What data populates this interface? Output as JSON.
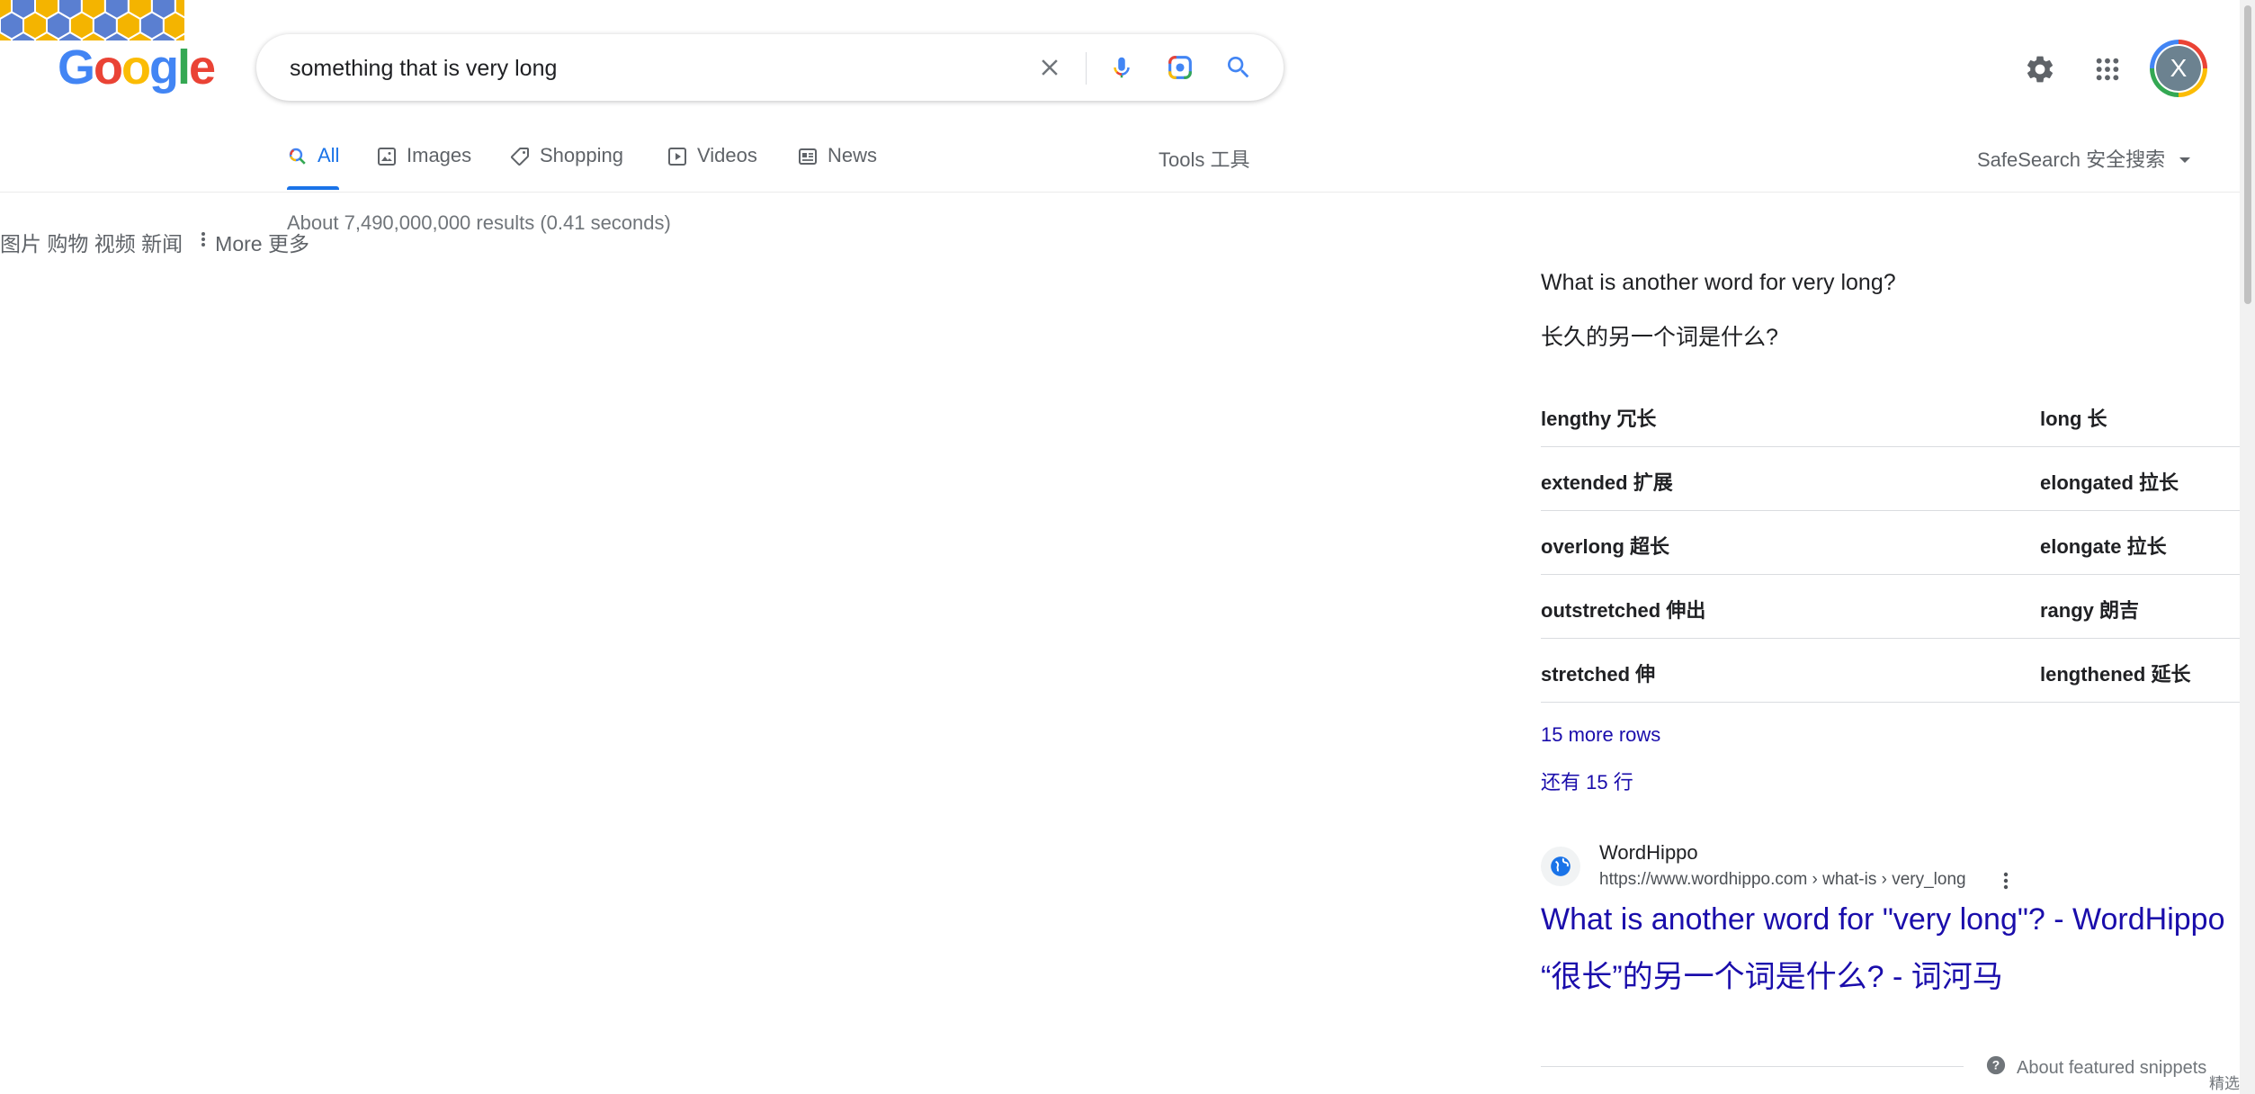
{
  "search": {
    "query": "something that is very long",
    "clear_icon": "close-icon",
    "voice_icon": "mic-icon",
    "lens_icon": "camera-lens-icon",
    "search_icon": "search-icon"
  },
  "logo": {
    "letters": [
      "G",
      "o",
      "o",
      "g",
      "l",
      "e"
    ]
  },
  "header": {
    "settings_icon": "gear-icon",
    "apps_icon": "apps-grid-icon",
    "avatar_initial": "X"
  },
  "tabs": [
    {
      "label": "All",
      "icon": "search-icon",
      "active": true
    },
    {
      "label": "Images",
      "icon": "image-icon"
    },
    {
      "label": "Shopping",
      "icon": "tag-icon"
    },
    {
      "label": "Videos",
      "icon": "play-icon"
    },
    {
      "label": "News",
      "icon": "newspaper-icon"
    }
  ],
  "tools_label": "Tools 工具",
  "safesearch_label": "SafeSearch 安全搜索",
  "more_cn": {
    "prefix": "图片 购物 视频 新闻",
    "label": "More 更多"
  },
  "result_stats": "About 7,490,000,000 results (0.41 seconds)",
  "featured": {
    "question_en": "What is another word for very long?",
    "question_cn": "长久的另一个词是什么?",
    "rows": [
      {
        "left": "lengthy 冗长",
        "right": "long 长"
      },
      {
        "left": "extended 扩展",
        "right": "elongated 拉长"
      },
      {
        "left": "overlong 超长",
        "right": "elongate 拉长"
      },
      {
        "left": "outstretched 伸出",
        "right": "rangy 朗吉"
      },
      {
        "left": "stretched 伸",
        "right": "lengthened 延长"
      }
    ],
    "more_rows_en": "15 more rows",
    "more_rows_cn": "还有 15 行",
    "source_name": "WordHippo",
    "source_url": "https://www.wordhippo.com › what-is › very_long",
    "title_en": "What is another word for \"very long\"? - WordHippo",
    "title_cn": "“很长”的另一个词是什么? - 词河马",
    "about_label": "About featured snippets",
    "about_cn": "精选"
  },
  "colors": {
    "accent": "#1a73e8",
    "link": "#1a0dab"
  }
}
